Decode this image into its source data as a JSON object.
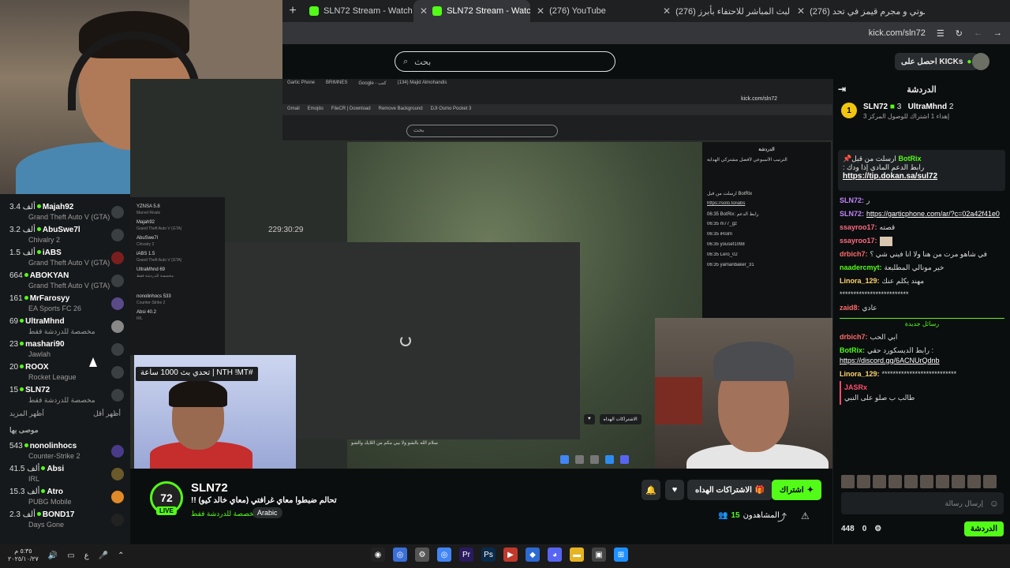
{
  "browser": {
    "tabs": [
      {
        "label": "(276) شوتي و مجرم قيمز في تحد",
        "color": "#ff0000"
      },
      {
        "label": "(276) البث المباشر للاحتفاء بأبرز",
        "color": "#ff0000"
      },
      {
        "label": "(276) YouTube",
        "color": "#ff0000"
      },
      {
        "label": "SLN72 Stream - Watch Live",
        "color": "#53fc18",
        "active": true
      }
    ],
    "newtab": "+",
    "url": "kick.com/sln72"
  },
  "header": {
    "search_placeholder": "بحث",
    "get_kicks": "احصل على KICKs"
  },
  "following": {
    "items": [
      {
        "count": "3.4 ألف",
        "name": "Majah92",
        "game": "Grand Theft Auto V (GTA)"
      },
      {
        "count": "3.2 ألف",
        "name": "AbuSwe7l",
        "game": "Chivalry 2"
      },
      {
        "count": "1.5 ألف",
        "name": "iABS",
        "game": "Grand Theft Auto V (GTA)"
      },
      {
        "count": "664",
        "name": "ABOKYAN",
        "game": "Grand Theft Auto V (GTA)"
      },
      {
        "count": "161",
        "name": "MrFarosyy",
        "game": "EA Sports FC 26"
      },
      {
        "count": "69",
        "name": "UltraMhnd",
        "game": "مخصصة للدردشة فقط"
      },
      {
        "count": "23",
        "name": "mashari90",
        "game": "Jawlah"
      },
      {
        "count": "20",
        "name": "ROOX",
        "game": "Rocket League"
      },
      {
        "count": "15",
        "name": "SLN72",
        "game": "مخصصة للدردشة فقط"
      }
    ],
    "show_more": "أظهر المزيد",
    "show_less": "أظهر أقل",
    "recommended_title": "موصى بها",
    "recommended": [
      {
        "count": "543",
        "name": "nonolinhocs",
        "game": "Counter-Strike 2"
      },
      {
        "count": "41.5 ألف",
        "name": "Absi",
        "game": "IRL"
      },
      {
        "count": "15.3 ألف",
        "name": "Atro",
        "game": "PUBG Mobile"
      },
      {
        "count": "2.3 ألف",
        "name": "BOND17",
        "game": "Days Gone"
      }
    ]
  },
  "nested": {
    "url": "kick.com/sln72",
    "search": "بحث",
    "timestamp": "229:30:29",
    "caption": "سلام الله بالشو ولا يبي مكم من اللايك والشو",
    "chat_title": "الدردشة",
    "chat_lines": [
      "الترتيب الأسبوعي لأفضل مشتركي الهداية",
      "ارسلت من قبل BotRix",
      "https://solo.to/iabs",
      "06:35 BotRix: رابط الدعم",
      "06:35 m77_gz",
      "06:35 iRoim",
      "06:35 yousef1098",
      "06:35 Lero_02",
      "06:35 yamanbaker_31"
    ],
    "left": [
      {
        "name": "YZNSA 5.8",
        "game": "Marvel Rivals"
      },
      {
        "name": "Majah92",
        "game": "Grand Theft Auto V (GTA)"
      },
      {
        "name": "AbuSwe7l",
        "game": "Chivalry 2"
      },
      {
        "name": "iABS 1.5",
        "game": "Grand Theft Auto V (GTA)"
      },
      {
        "name": "UltraMhnd 69",
        "game": "مخصصة للدردشة فقط"
      },
      {
        "name": "nonolinhocs 533",
        "game": "Counter-Strike 2"
      },
      {
        "name": "Absi 40.2",
        "game": "IRL"
      }
    ],
    "subscribe_gift": "الاشتراكات الهداه",
    "viewers": "1.6"
  },
  "challenge_banner": "تحدي بث 1000 ساعة | NTH !MT#",
  "channel": {
    "avatar_text": "72",
    "live": "LIVE",
    "name": "SLN72",
    "title": "!! تحالم ضبطوا معاي غرافتي (معاي خالد كيو)",
    "category": "مخصصة للدردشة فقط",
    "language": "Arabic",
    "subscribe": "اشتراك",
    "gift": "الاشتراكات الهداه",
    "viewers_label": "المشاهدون",
    "viewers_count": "15"
  },
  "chat": {
    "title": "الدردشة",
    "leader": {
      "rank1": "SLN72",
      "rank1_count": "3",
      "rank2": "UltraMhnd",
      "rank2_count": "2",
      "sub": "إهداء 1 اشتراك للوصول المركز 3"
    },
    "pinned": {
      "from": "ارسلت من قبل",
      "user": "BotRix",
      "text": ": رابط الدعم المادي إذا ودك",
      "link": "https://tip.dokan.sa/sul72"
    },
    "messages": [
      {
        "user": "SLN72:",
        "text": "ر",
        "color": "#c084fc"
      },
      {
        "user": "SLN72:",
        "text": "",
        "link": "https://garticphone.com/ar/?c=02a42f41e0",
        "color": "#c084fc"
      },
      {
        "user": "ssayroo17:",
        "text": "قصته",
        "color": "#ff6b81"
      },
      {
        "user": "ssayroo17:",
        "text": "",
        "color": "#ff6b81"
      },
      {
        "user": "drbich7:",
        "text": "في شاهو مرت من هنا ولا انا فيني شي ؟",
        "color": "#ff6b6b"
      },
      {
        "user": "naadercmyt:",
        "text": "خير مونالي المطلبعة",
        "color": "#53fc18"
      },
      {
        "user": "Linora_129:",
        "text": "مهند يكلم عنك",
        "color": "#ffd36b"
      },
      {
        "user": "",
        "text": "*************************",
        "color": "#ffffff"
      },
      {
        "user": "zaid8:",
        "text": "عادي",
        "color": "#ff6b6b"
      }
    ],
    "new_messages": "رسائل جديدة",
    "messages2": [
      {
        "user": "drbich7:",
        "text": "ابي الحب",
        "color": "#ff6b6b"
      },
      {
        "user": "BotRix:",
        "text": "رابط الديسكورد حقي :",
        "link": "https://discord.gg/6ACNUrQdnb",
        "color": "#53fc18"
      },
      {
        "user": "Linora_129:",
        "text": "***************************",
        "color": "#ffd36b"
      },
      {
        "user": "JASRx",
        "text": "طالب ب صلو على النبي",
        "color": "#ff4d6d"
      }
    ],
    "input_placeholder": "إرسال رسالة",
    "chat_button": "الدردشة",
    "kicks_count": "448",
    "zero": "0"
  },
  "taskbar": {
    "clock_time": "٥:٣٥ م",
    "clock_date": "٢٠٢٥/١٠/٢٧",
    "lang": "ع"
  }
}
